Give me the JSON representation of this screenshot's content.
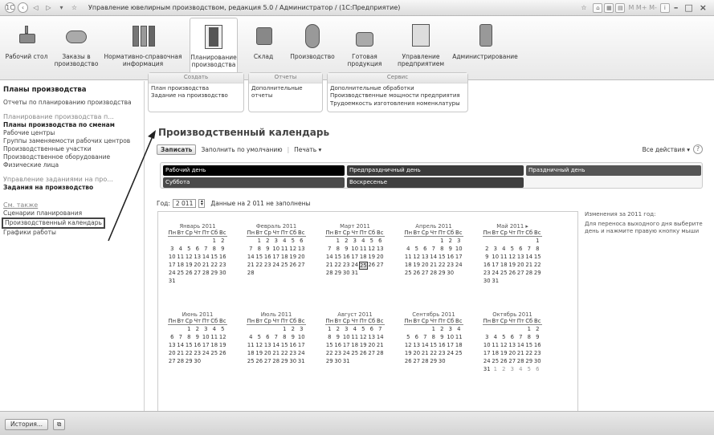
{
  "window": {
    "title": "Управление ювелирным производством, редакция 5.0 / Администратор / (1С:Предприятие)",
    "right_text": "M  M+  M-"
  },
  "sections": [
    {
      "label": "Рабочий стол",
      "icon": "desktop-icon"
    },
    {
      "label": "Заказы в производство",
      "icon": "orders-icon"
    },
    {
      "label": "Нормативно-справочная информация",
      "icon": "books-icon"
    },
    {
      "label": "Планирование производства",
      "icon": "planning-icon"
    },
    {
      "label": "Склад",
      "icon": "warehouse-icon"
    },
    {
      "label": "Производство",
      "icon": "production-icon"
    },
    {
      "label": "Готовая продукция",
      "icon": "finished-products-icon"
    },
    {
      "label": "Управление предприятием",
      "icon": "management-icon"
    },
    {
      "label": "Администрирование",
      "icon": "admin-icon"
    }
  ],
  "left": {
    "heading": "Планы производства",
    "reports": "Отчеты по планированию производства",
    "group_title": "Планирование производства п...",
    "group_items": [
      "Планы производства по сменам",
      "Рабочие центры",
      "Группы заменяемости рабочих центров",
      "Производственные участки",
      "Производственное оборудование",
      "Физические лица"
    ],
    "tasks_title": "Управление заданиями на про...",
    "tasks_item": "Задания на производство",
    "see_also": "См. также",
    "see_items": [
      "Сценарии планирования",
      "Производственный календарь",
      "Графики работы"
    ]
  },
  "actions": {
    "create": {
      "title": "Создать",
      "items": [
        "План производства",
        "Задание на производство"
      ]
    },
    "reports": {
      "title": "Отчеты",
      "items": [
        "Дополнительные отчеты"
      ]
    },
    "service": {
      "title": "Сервис",
      "items": [
        "Дополнительные обработки",
        "Производственные мощности предприятия",
        "Трудоемкость изготовления номенклатуры"
      ]
    }
  },
  "form": {
    "title": "Производственный календарь",
    "save": "Записать",
    "fill": "Заполнить по умолчанию",
    "print": "Печать ▾",
    "all_actions": "Все действия ▾",
    "help": "?",
    "legend": {
      "work": "Рабочий день",
      "preholiday": "Предпраздничный день",
      "holiday": "Праздничный день",
      "saturday": "Суббота",
      "sunday": "Воскресенье"
    },
    "legend_colors": {
      "work": "#000000",
      "preholiday": "#3a3a3a",
      "holiday": "#555555",
      "saturday": "#4a4a4a",
      "sunday": "#3f3f3f"
    },
    "year_label": "Год:",
    "year_value": "2 011",
    "year_note": "Данные на 2 011 не заполнены",
    "side_title": "Изменения за 2011 год:",
    "side_text": "Для переноса выходного дня выберите день и нажмите правую кнопку мыши"
  },
  "calendar": {
    "weekdays": [
      "Пн",
      "Вт",
      "Ср",
      "Чт",
      "Пт",
      "Сб",
      "Вс"
    ],
    "today": "25",
    "months": [
      {
        "name": "Январь 2011",
        "weeks": [
          [
            "",
            "",
            "",
            "",
            "",
            "1",
            "2"
          ],
          [
            "3",
            "4",
            "5",
            "6",
            "7",
            "8",
            "9"
          ],
          [
            "10",
            "11",
            "12",
            "13",
            "14",
            "15",
            "16"
          ],
          [
            "17",
            "18",
            "19",
            "20",
            "21",
            "22",
            "23"
          ],
          [
            "24",
            "25",
            "26",
            "27",
            "28",
            "29",
            "30"
          ],
          [
            "31",
            "",
            "",
            "",
            "",
            "",
            ""
          ]
        ]
      },
      {
        "name": "Февраль 2011",
        "weeks": [
          [
            "",
            "1",
            "2",
            "3",
            "4",
            "5",
            "6"
          ],
          [
            "7",
            "8",
            "9",
            "10",
            "11",
            "12",
            "13"
          ],
          [
            "14",
            "15",
            "16",
            "17",
            "18",
            "19",
            "20"
          ],
          [
            "21",
            "22",
            "23",
            "24",
            "25",
            "26",
            "27"
          ],
          [
            "28",
            "",
            "",
            "",
            "",
            "",
            ""
          ]
        ]
      },
      {
        "name": "Март 2011",
        "weeks": [
          [
            "",
            "1",
            "2",
            "3",
            "4",
            "5",
            "6"
          ],
          [
            "7",
            "8",
            "9",
            "10",
            "11",
            "12",
            "13"
          ],
          [
            "14",
            "15",
            "16",
            "17",
            "18",
            "19",
            "20"
          ],
          [
            "21",
            "22",
            "23",
            "24",
            "25",
            "26",
            "27"
          ],
          [
            "28",
            "29",
            "30",
            "31",
            "",
            "",
            ""
          ]
        ]
      },
      {
        "name": "Апрель 2011",
        "weeks": [
          [
            "",
            "",
            "",
            "",
            "1",
            "2",
            "3"
          ],
          [
            "4",
            "5",
            "6",
            "7",
            "8",
            "9",
            "10"
          ],
          [
            "11",
            "12",
            "13",
            "14",
            "15",
            "16",
            "17"
          ],
          [
            "18",
            "19",
            "20",
            "21",
            "22",
            "23",
            "24"
          ],
          [
            "25",
            "26",
            "27",
            "28",
            "29",
            "30",
            ""
          ]
        ]
      },
      {
        "name": "Май 2011   ▸",
        "weeks": [
          [
            "",
            "",
            "",
            "",
            "",
            "",
            "1"
          ],
          [
            "2",
            "3",
            "4",
            "5",
            "6",
            "7",
            "8"
          ],
          [
            "9",
            "10",
            "11",
            "12",
            "13",
            "14",
            "15"
          ],
          [
            "16",
            "17",
            "18",
            "19",
            "20",
            "21",
            "22"
          ],
          [
            "23",
            "24",
            "25",
            "26",
            "27",
            "28",
            "29"
          ],
          [
            "30",
            "31",
            "",
            "",
            "",
            "",
            ""
          ]
        ]
      },
      {
        "name": "Июнь 2011",
        "weeks": [
          [
            "",
            "",
            "1",
            "2",
            "3",
            "4",
            "5"
          ],
          [
            "6",
            "7",
            "8",
            "9",
            "10",
            "11",
            "12"
          ],
          [
            "13",
            "14",
            "15",
            "16",
            "17",
            "18",
            "19"
          ],
          [
            "20",
            "21",
            "22",
            "23",
            "24",
            "25",
            "26"
          ],
          [
            "27",
            "28",
            "29",
            "30",
            "",
            "",
            ""
          ]
        ]
      },
      {
        "name": "Июль 2011",
        "weeks": [
          [
            "",
            "",
            "",
            "",
            "1",
            "2",
            "3"
          ],
          [
            "4",
            "5",
            "6",
            "7",
            "8",
            "9",
            "10"
          ],
          [
            "11",
            "12",
            "13",
            "14",
            "15",
            "16",
            "17"
          ],
          [
            "18",
            "19",
            "20",
            "21",
            "22",
            "23",
            "24"
          ],
          [
            "25",
            "26",
            "27",
            "28",
            "29",
            "30",
            "31"
          ]
        ]
      },
      {
        "name": "Август 2011",
        "weeks": [
          [
            "1",
            "2",
            "3",
            "4",
            "5",
            "6",
            "7"
          ],
          [
            "8",
            "9",
            "10",
            "11",
            "12",
            "13",
            "14"
          ],
          [
            "15",
            "16",
            "17",
            "18",
            "19",
            "20",
            "21"
          ],
          [
            "22",
            "23",
            "24",
            "25",
            "26",
            "27",
            "28"
          ],
          [
            "29",
            "30",
            "31",
            "",
            "",
            "",
            ""
          ]
        ]
      },
      {
        "name": "Сентябрь 2011",
        "weeks": [
          [
            "",
            "",
            "",
            "1",
            "2",
            "3",
            "4"
          ],
          [
            "5",
            "6",
            "7",
            "8",
            "9",
            "10",
            "11"
          ],
          [
            "12",
            "13",
            "14",
            "15",
            "16",
            "17",
            "18"
          ],
          [
            "19",
            "20",
            "21",
            "22",
            "23",
            "24",
            "25"
          ],
          [
            "26",
            "27",
            "28",
            "29",
            "30",
            "",
            ""
          ]
        ]
      },
      {
        "name": "Октябрь 2011",
        "weeks": [
          [
            "",
            "",
            "",
            "",
            "",
            "1",
            "2"
          ],
          [
            "3",
            "4",
            "5",
            "6",
            "7",
            "8",
            "9"
          ],
          [
            "10",
            "11",
            "12",
            "13",
            "14",
            "15",
            "16"
          ],
          [
            "17",
            "18",
            "19",
            "20",
            "21",
            "22",
            "23"
          ],
          [
            "24",
            "25",
            "26",
            "27",
            "28",
            "29",
            "30"
          ],
          [
            "31",
            "1",
            "2",
            "3",
            "4",
            "5",
            "6"
          ]
        ]
      }
    ]
  },
  "bottom": {
    "history": "История...",
    "icon": "windows-icon"
  }
}
